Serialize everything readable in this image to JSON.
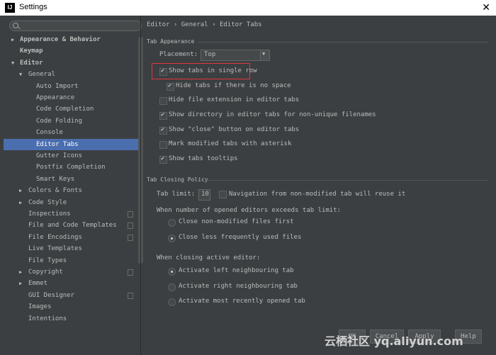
{
  "window": {
    "title": "Settings",
    "app_icon": "IJ"
  },
  "sidebar": {
    "search_placeholder": "",
    "items": [
      {
        "label": "Appearance & Behavior",
        "arrow": "▶",
        "bold": true
      },
      {
        "label": "Keymap",
        "arrow": "",
        "bold": true
      },
      {
        "label": "Editor",
        "arrow": "▼",
        "bold": true
      },
      {
        "label": "General",
        "arrow": "▼",
        "bold": false
      },
      {
        "label": "Auto Import",
        "arrow": "",
        "bold": false
      },
      {
        "label": "Appearance",
        "arrow": "",
        "bold": false
      },
      {
        "label": "Code Completion",
        "arrow": "",
        "bold": false
      },
      {
        "label": "Code Folding",
        "arrow": "",
        "bold": false
      },
      {
        "label": "Console",
        "arrow": "",
        "bold": false
      },
      {
        "label": "Editor Tabs",
        "arrow": "",
        "bold": false,
        "selected": true
      },
      {
        "label": "Gutter Icons",
        "arrow": "",
        "bold": false
      },
      {
        "label": "Postfix Completion",
        "arrow": "",
        "bold": false
      },
      {
        "label": "Smart Keys",
        "arrow": "",
        "bold": false
      },
      {
        "label": "Colors & Fonts",
        "arrow": "▶",
        "bold": false
      },
      {
        "label": "Code Style",
        "arrow": "▶",
        "bold": false
      },
      {
        "label": "Inspections",
        "arrow": "",
        "bold": false,
        "icon": true
      },
      {
        "label": "File and Code Templates",
        "arrow": "",
        "bold": false,
        "icon": true
      },
      {
        "label": "File Encodings",
        "arrow": "",
        "bold": false,
        "icon": true
      },
      {
        "label": "Live Templates",
        "arrow": "",
        "bold": false
      },
      {
        "label": "File Types",
        "arrow": "",
        "bold": false
      },
      {
        "label": "Copyright",
        "arrow": "▶",
        "bold": false,
        "icon": true
      },
      {
        "label": "Emmet",
        "arrow": "▶",
        "bold": false
      },
      {
        "label": "GUI Designer",
        "arrow": "",
        "bold": false,
        "icon": true
      },
      {
        "label": "Images",
        "arrow": "",
        "bold": false
      },
      {
        "label": "Intentions",
        "arrow": "",
        "bold": false
      }
    ]
  },
  "breadcrumb": "Editor › General › Editor Tabs",
  "tab_appearance": {
    "header": "Tab Appearance",
    "placement_label": "Placement:",
    "placement_value": "Top",
    "options": [
      {
        "label": "Show tabs in single row",
        "checked": true
      },
      {
        "label": "Hide tabs if there is no space",
        "checked": true
      },
      {
        "label": "Hide file extension in editor tabs",
        "checked": false
      },
      {
        "label": "Show directory in editor tabs for non-unique filenames",
        "checked": true
      },
      {
        "label": "Show \"close\" button on editor tabs",
        "checked": true
      },
      {
        "label": "Mark modified tabs with asterisk",
        "checked": false
      },
      {
        "label": "Show tabs tooltips",
        "checked": true
      }
    ]
  },
  "tab_closing": {
    "header": "Tab Closing Policy",
    "limit_label": "Tab limit:",
    "limit_value": "10",
    "nav_label": "Navigation from non-modified tab will reuse it",
    "nav_checked": false,
    "exceed_label": "When number of opened editors exceeds tab limit:",
    "exceed_options": [
      {
        "label": "Close non-modified files first",
        "checked": false
      },
      {
        "label": "Close less frequently used files",
        "checked": true
      }
    ],
    "active_label": "When closing active editor:",
    "active_options": [
      {
        "label": "Activate left neighbouring tab",
        "checked": true
      },
      {
        "label": "Activate right neighbouring tab",
        "checked": false
      },
      {
        "label": "Activate most recently opened tab",
        "checked": false
      }
    ]
  },
  "footer": {
    "ok": "OK",
    "cancel": "Cancel",
    "apply": "Apply",
    "help": "Help"
  },
  "watermark": "云栖社区 yq.aliyun.com",
  "colors": {
    "accent": "#4b6eaf",
    "highlight": "#e0363f",
    "background": "#3c3f41"
  }
}
